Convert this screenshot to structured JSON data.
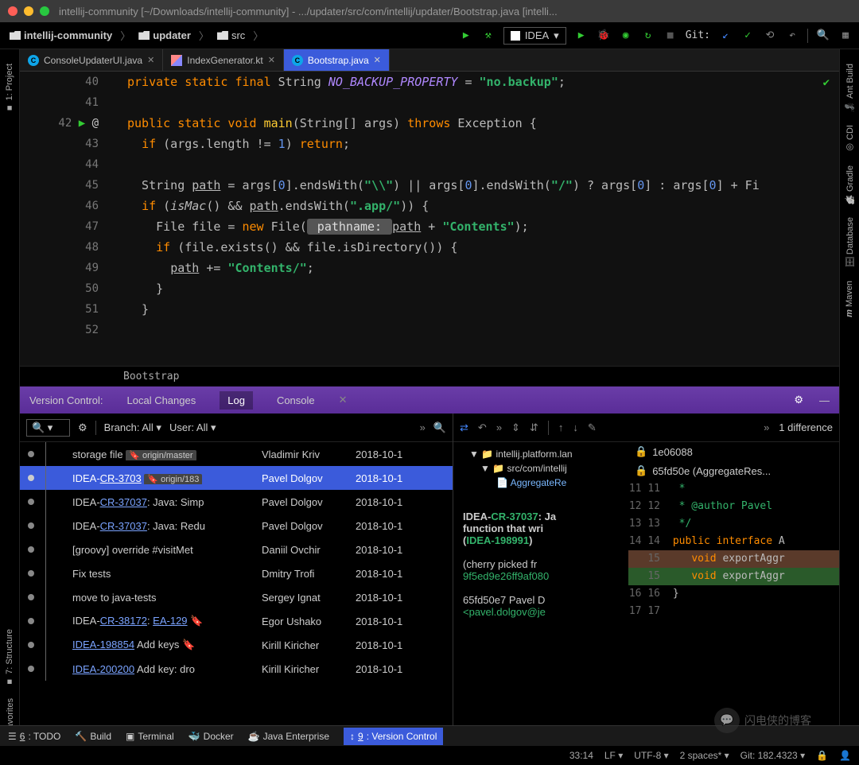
{
  "title": "intellij-community [~/Downloads/intellij-community] - .../updater/src/com/intellij/updater/Bootstrap.java [intelli...",
  "breadcrumb": [
    "intellij-community",
    "updater",
    "src"
  ],
  "run_config": "IDEA",
  "git_label": "Git:",
  "tabs": [
    {
      "label": "ConsoleUpdaterUI.java",
      "type": "java",
      "active": false
    },
    {
      "label": "IndexGenerator.kt",
      "type": "kt",
      "active": false
    },
    {
      "label": "Bootstrap.java",
      "type": "java",
      "active": true
    }
  ],
  "left_rail": [
    "1: Project"
  ],
  "right_rail": [
    "Ant Build",
    "CDI",
    "Gradle",
    "Database",
    "Maven"
  ],
  "code_lines": [
    {
      "n": 40,
      "html": "<span class='kw'>private static final</span> String <span class='it'>NO_BACKUP_PROPERTY</span> = <span class='str'>\"no.backup\"</span>;"
    },
    {
      "n": 41,
      "html": ""
    },
    {
      "n": 42,
      "html": "<span class='kw'>public static void</span> <span class='fn'>main</span>(String[] args) <span class='kw'>throws</span> Exception {",
      "play": true,
      "at": "@"
    },
    {
      "n": 43,
      "html": "  <span class='kw'>if</span> (args.length != <span class='num'>1</span>) <span class='kw'>return</span>;"
    },
    {
      "n": 44,
      "html": ""
    },
    {
      "n": 45,
      "html": "  String <span class='ul'>path</span> = args[<span class='num'>0</span>].endsWith(<span class='str'>\"\\\\\"</span>) || args[<span class='num'>0</span>].endsWith(<span class='str'>\"/\"</span>) ? args[<span class='num'>0</span>] : args[<span class='num'>0</span>] + Fi"
    },
    {
      "n": 46,
      "html": "  <span class='kw'>if</span> (<span style='font-style:italic'>isMac</span>() && <span class='ul'>path</span>.endsWith(<span class='str'>\".app/\"</span>)) {"
    },
    {
      "n": 47,
      "html": "    File file = <span class='kw'>new</span> File(<span style='background:#555;color:#ddd;padding:1px 4px;border-radius:3px'> pathname: </span><span class='ul'>path</span> + <span class='str'>\"Contents\"</span>);"
    },
    {
      "n": 48,
      "html": "    <span class='kw'>if</span> (file.exists() && file.isDirectory()) {"
    },
    {
      "n": 49,
      "html": "      <span class='ul'>path</span> += <span class='str'>\"Contents/\"</span>;"
    },
    {
      "n": 50,
      "html": "    }"
    },
    {
      "n": 51,
      "html": "  }"
    },
    {
      "n": 52,
      "html": ""
    }
  ],
  "editor_breadcrumb": "Bootstrap",
  "vcs": {
    "header_label": "Version Control:",
    "tabs": [
      "Local Changes",
      "Log",
      "Console"
    ],
    "active_tab": "Log",
    "log_toolbar": {
      "branch": "Branch: All",
      "user": "User: All"
    },
    "rows": [
      {
        "subj": "storage file",
        "tag": "origin/master",
        "author": "Vladimir Kriv",
        "date": "2018-10-1"
      },
      {
        "subj": "IDEA-<span class='link'>CR-3703</span>",
        "tag": "origin/183",
        "author": "Pavel Dolgov",
        "date": "2018-10-1",
        "sel": true
      },
      {
        "subj": "IDEA-<span class='link'>CR-37037</span>: Java: Simp",
        "author": "Pavel Dolgov",
        "date": "2018-10-1"
      },
      {
        "subj": "IDEA-<span class='link'>CR-37037</span>: Java: Redu",
        "author": "Pavel Dolgov",
        "date": "2018-10-1"
      },
      {
        "subj": "[groovy] override #visitMet",
        "author": "Daniil Ovchir",
        "date": "2018-10-1"
      },
      {
        "subj": "Fix tests",
        "author": "Dmitry Trofi",
        "date": "2018-10-1"
      },
      {
        "subj": "move to java-tests",
        "author": "Sergey Ignat",
        "date": "2018-10-1"
      },
      {
        "subj": "IDEA-<span class='link'>CR-38172</span>: <span class='link'>EA-129</span>",
        "tag_icon": true,
        "author": "Egor Ushako",
        "date": "2018-10-1"
      },
      {
        "subj": "<span class='link'>IDEA-198854</span> Add keys",
        "tag_icon": true,
        "author": "Kirill Kiricher",
        "date": "2018-10-1"
      },
      {
        "subj": "<span class='link'>IDEA-200200</span> Add key: dro",
        "author": "Kirill Kiricher",
        "date": "2018-10-1"
      }
    ],
    "diff_tree": {
      "root": "intellij.platform.lan",
      "sub": "src/com/intellij",
      "file": "AggregateRe"
    },
    "commit_msg": {
      "l1": "IDEA-CR-37037: Ja",
      "l2": "function that wri",
      "l3": "(IDEA-198991)",
      "l4": "(cherry picked fr",
      "hash": "9f5ed9e26ff9af080",
      "l5": "65fd50e7 Pavel D",
      "l6": "<pavel.dolgov@je"
    },
    "hashes": [
      "1e06088",
      "65fd50e (AggregateRes..."
    ],
    "diff_counter": "1 difference",
    "diff_lines": [
      {
        "l": "11",
        "r": "11",
        "t": "  *",
        "cls": "cmt"
      },
      {
        "l": "12",
        "r": "12",
        "t": "  * @author Pavel",
        "cls": "cmt"
      },
      {
        "l": "13",
        "r": "13",
        "t": "  */",
        "cls": "cmt"
      },
      {
        "l": "14",
        "r": "14",
        "t": " public interface A",
        "cls": ""
      },
      {
        "l": "15",
        "r": "",
        "t": "    void exportAggr",
        "cls": "del"
      },
      {
        "l": "",
        "r": "15",
        "t": "    void exportAggr",
        "cls": "add"
      },
      {
        "l": "16",
        "r": "16",
        "t": " }",
        "cls": ""
      },
      {
        "l": "17",
        "r": "17",
        "t": "",
        "cls": ""
      }
    ]
  },
  "bottom_tabs": [
    "6: TODO",
    "Build",
    "Terminal",
    "Docker",
    "Java Enterprise",
    "9: Version Control"
  ],
  "status": {
    "pos": "33:14",
    "le": "LF",
    "enc": "UTF-8",
    "indent": "2 spaces*",
    "git": "Git: 182.4323"
  },
  "watermark": "闪电侠的博客"
}
